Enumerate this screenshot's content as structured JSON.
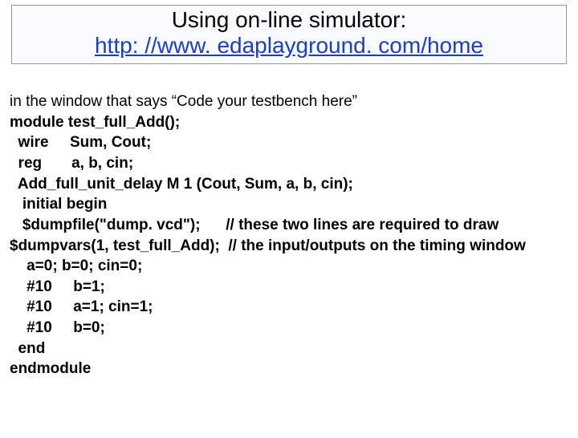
{
  "title": {
    "line1": "Using on-line simulator:",
    "link": "http: //www. edaplayground. com/home"
  },
  "intro": "in the window that says “Code your testbench here”",
  "code": {
    "l01": "module test_full_Add();",
    "l02": "  wire     Sum, Cout;",
    "l03": "  reg       a, b, cin;",
    "l04": "  Add_full_unit_delay M 1 (Cout, Sum, a, b, cin);",
    "l05": "   initial begin",
    "l06": "   $dumpfile(\"dump. vcd\");      // these two lines are required to draw",
    "l07": "$dumpvars(1, test_full_Add);  // the input/outputs on the timing window",
    "l08": "    a=0; b=0; cin=0;",
    "l09": "    #10     b=1;",
    "l10": "    #10     a=1; cin=1;",
    "l11": "    #10     b=0;",
    "l12": "  end",
    "l13": "endmodule"
  }
}
